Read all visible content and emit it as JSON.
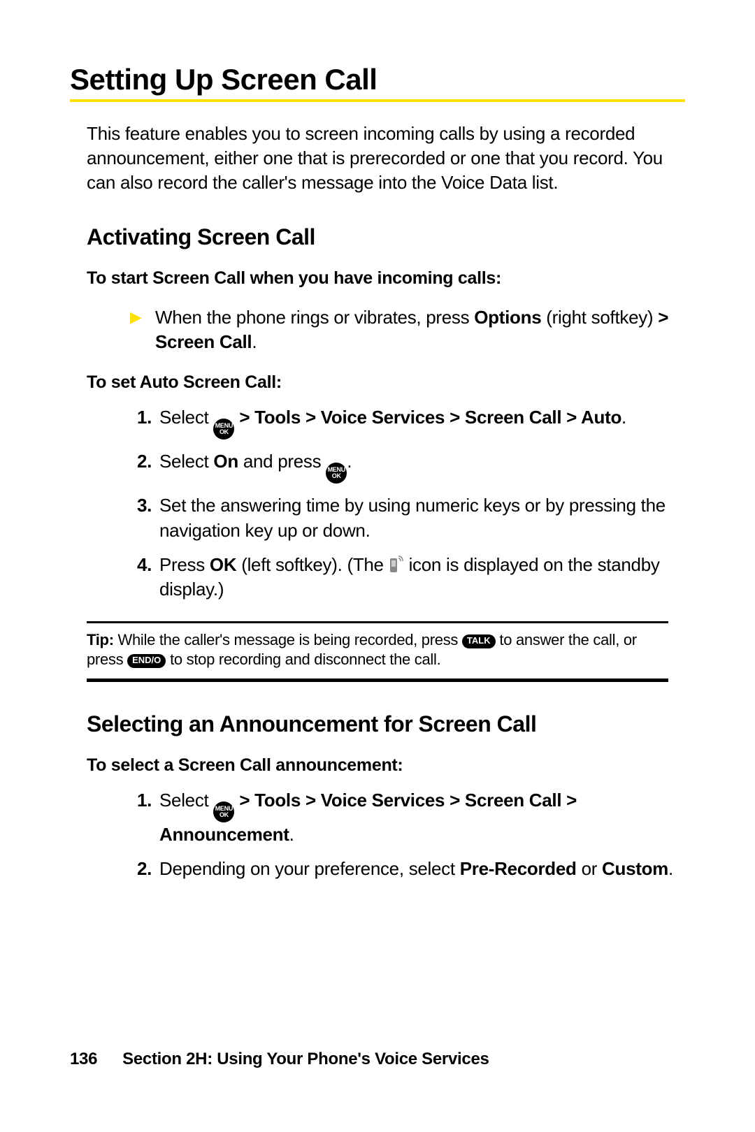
{
  "title": "Setting Up Screen Call",
  "intro": "This feature enables you to screen incoming calls by using a recorded announcement, either one that is prerecorded or one that you record. You can also record the caller's message into the Voice Data list.",
  "subheading1": "Activating Screen Call",
  "lead1": "To start Screen Call when you have incoming calls:",
  "arrow1_pre": "When the phone rings or vibrates, press ",
  "arrow1_b1": "Options",
  "arrow1_mid": " (right softkey) ",
  "arrow1_b2": "> Screen Call",
  "arrow1_post": ".",
  "lead2": "To set Auto Screen Call:",
  "step1_pre": "Select ",
  "step1_b": " > Tools > Voice Services > Screen Call > Auto",
  "step1_post": ".",
  "step2_pre": "Select ",
  "step2_b": "On",
  "step2_mid": " and press ",
  "step2_post": ".",
  "step3": "Set the answering time by using numeric keys or by pressing the navigation key up or down.",
  "step4_pre": "Press ",
  "step4_b": "OK",
  "step4_mid": " (left softkey). (The ",
  "step4_post": " icon is displayed on the standby display.)",
  "tip_b": "Tip:",
  "tip_pre": " While the caller's message is being recorded, press ",
  "tip_mid": " to answer the call, or press ",
  "tip_post": " to stop recording and disconnect the call.",
  "subheading2": "Selecting an Announcement for Screen Call",
  "lead3": "To select a Screen Call announcement:",
  "s2step1_pre": "Select ",
  "s2step1_b": " > Tools > Voice Services > Screen Call > Announcement",
  "s2step1_post": ".",
  "s2step2_pre": "Depending on your preference, select ",
  "s2step2_b1": "Pre-Recorded",
  "s2step2_mid": " or ",
  "s2step2_b2": "Custom",
  "s2step2_post": ".",
  "page_number": "136",
  "section_label": "Section 2H: Using Your Phone's Voice Services",
  "pill_talk": "TALK",
  "pill_end": "END/O"
}
